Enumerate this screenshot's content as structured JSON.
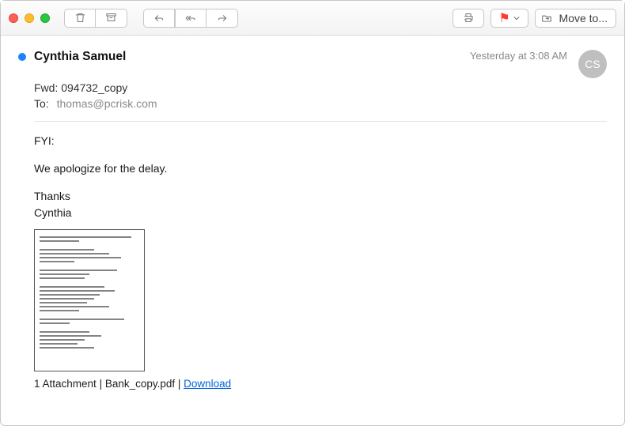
{
  "toolbar": {
    "moveto_label": "Move to..."
  },
  "header": {
    "from": "Cynthia Samuel",
    "date": "Yesterday at 3:08 AM",
    "avatar": "CS",
    "subject": "Fwd: 094732_copy",
    "to_label": "To:",
    "to_addr": "thomas@pcrisk.com"
  },
  "body": {
    "l1": "FYI:",
    "l2": "We apologize for the delay.",
    "l3": "Thanks",
    "l4": "Cynthia"
  },
  "attachment": {
    "count_text": "1 Attachment",
    "sep": " | ",
    "filename": "Bank_copy.pdf",
    "download": "Download"
  }
}
